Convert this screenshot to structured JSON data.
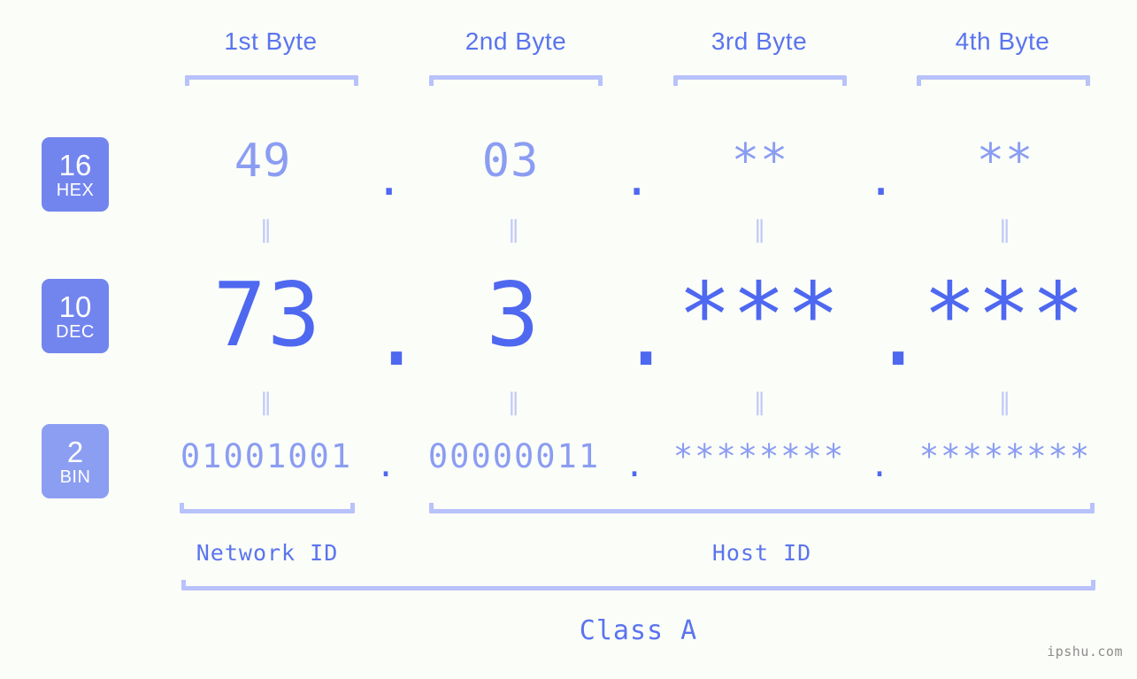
{
  "meta": {
    "background_color": "#fbfdf8",
    "accent_color": "#4e68f0",
    "accent_light_color": "#8b9df2",
    "bracket_color": "#b8c2fb",
    "badge_color": "#7285ee",
    "watermark": "ipshu.com"
  },
  "byte_headers": [
    {
      "label": "1st Byte"
    },
    {
      "label": "2nd Byte"
    },
    {
      "label": "3rd Byte"
    },
    {
      "label": "4th Byte"
    }
  ],
  "bases": [
    {
      "number": "16",
      "unit": "HEX"
    },
    {
      "number": "10",
      "unit": "DEC"
    },
    {
      "number": "2",
      "unit": "BIN"
    }
  ],
  "rows": {
    "hex": {
      "base_number": "16",
      "base_unit": "HEX",
      "values": [
        "49",
        "03",
        "**",
        "**"
      ],
      "separator": "."
    },
    "dec": {
      "base_number": "10",
      "base_unit": "DEC",
      "values": [
        "73",
        "3",
        "***",
        "***"
      ],
      "separator": "."
    },
    "bin": {
      "base_number": "2",
      "base_unit": "BIN",
      "values": [
        "01001001",
        "00000011",
        "********",
        "********"
      ],
      "separator": "."
    }
  },
  "equals_marks": {
    "symbol": "‖",
    "count_per_row": 4
  },
  "id_sections": [
    {
      "label": "Network ID"
    },
    {
      "label": "Host ID"
    }
  ],
  "class": {
    "label": "Class A"
  }
}
